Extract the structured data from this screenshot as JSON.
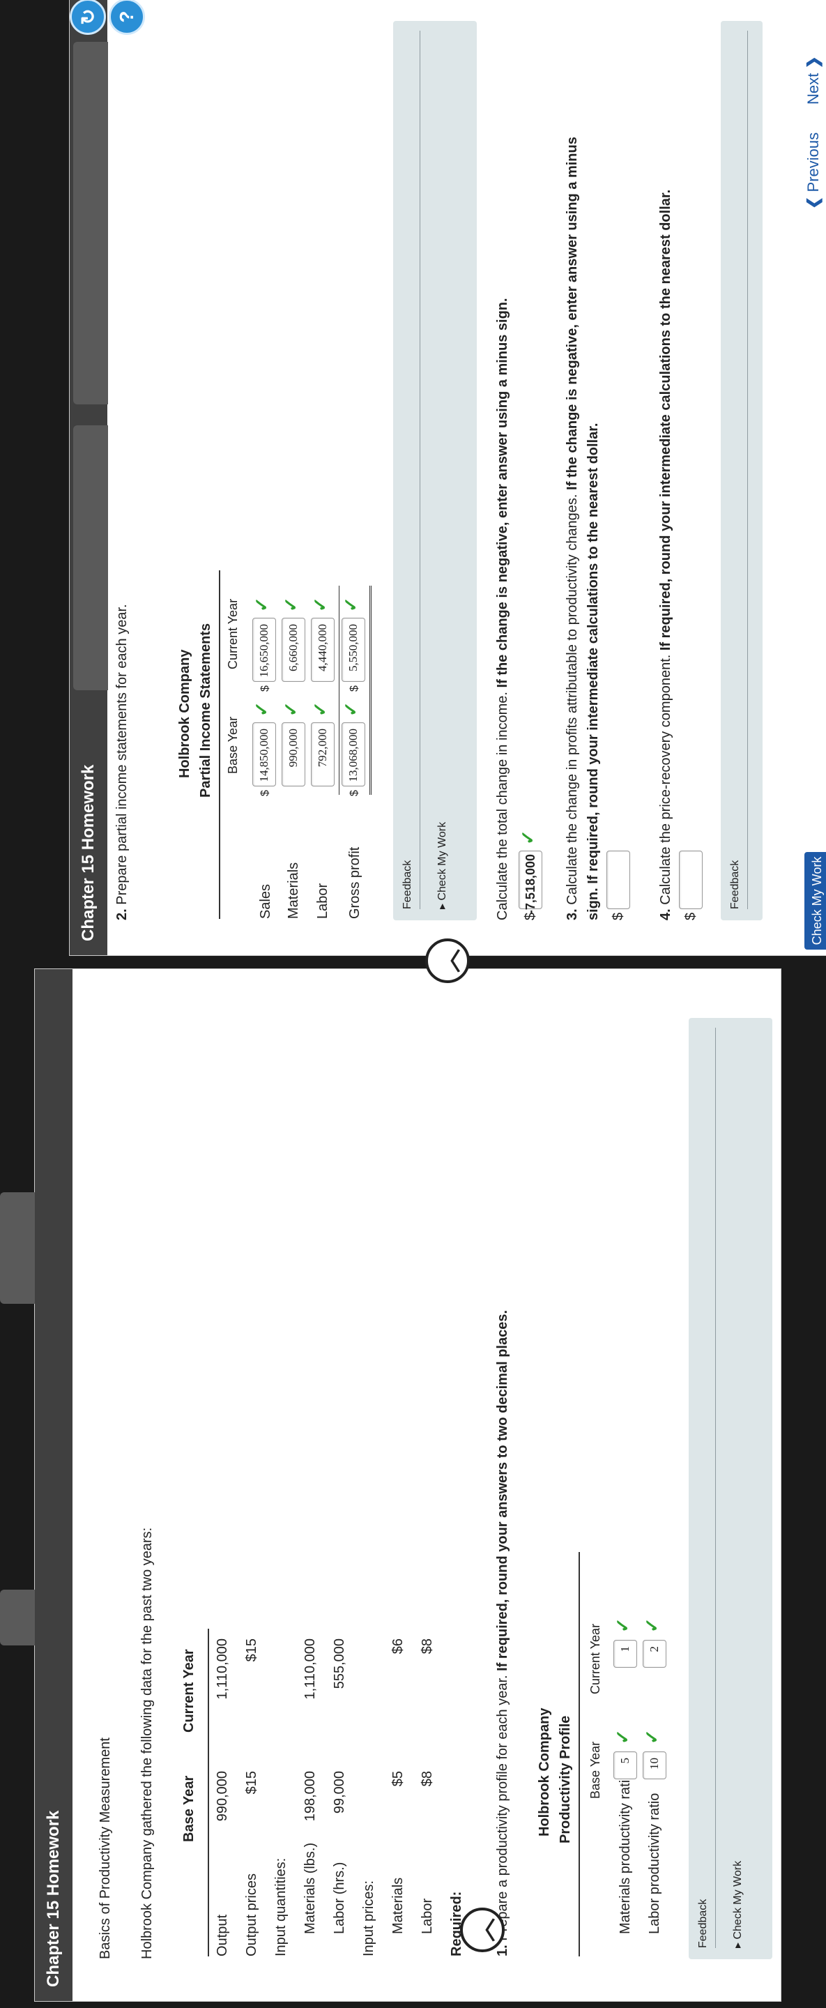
{
  "panel1": {
    "header": "Chapter 15 Homework",
    "title": "Basics of Productivity Measurement",
    "intro": "Holbrook Company gathered the following data for the past two years:",
    "table": {
      "col_base": "Base Year",
      "col_current": "Current Year",
      "rows": [
        {
          "label": "Output",
          "base": "990,000",
          "current": "1,110,000"
        },
        {
          "label": "Output prices",
          "base": "$15",
          "current": "$15"
        },
        {
          "label": "Input quantities:",
          "base": "",
          "current": ""
        },
        {
          "label": "Materials (lbs.)",
          "base": "198,000",
          "current": "1,110,000"
        },
        {
          "label": "Labor (hrs.)",
          "base": "99,000",
          "current": "555,000"
        },
        {
          "label": "Input prices:",
          "base": "",
          "current": ""
        },
        {
          "label": "Materials",
          "base": "$5",
          "current": "$6"
        },
        {
          "label": "Labor",
          "base": "$8",
          "current": "$8"
        }
      ]
    },
    "required_label": "Required:",
    "q1_prefix": "1.",
    "q1_text": "Prepare a productivity profile for each year.",
    "q1_bold": "If required, round your answers to two decimal places.",
    "profile": {
      "company": "Holbrook Company",
      "title": "Productivity Profile",
      "col_base": "Base Year",
      "col_current": "Current Year",
      "rows": [
        {
          "label": "Materials productivity ratio",
          "base": "5",
          "current": "1"
        },
        {
          "label": "Labor productivity ratio",
          "base": "10",
          "current": "2"
        }
      ]
    },
    "feedback_label": "Feedback",
    "check_my_work": "Check My Work"
  },
  "panel2": {
    "header": "Chapter 15 Homework",
    "q2_prefix": "2.",
    "q2_text": "Prepare partial income statements for each year.",
    "statement": {
      "company": "Holbrook Company",
      "title": "Partial Income Statements",
      "col_base": "Base Year",
      "col_current": "Current Year",
      "rows": [
        {
          "label": "Sales",
          "dollar": "$",
          "base": "14,850,000",
          "current": "16,650,000"
        },
        {
          "label": "Materials",
          "dollar": "",
          "base": "990,000",
          "current": "6,660,000"
        },
        {
          "label": "Labor",
          "dollar": "",
          "base": "792,000",
          "current": "4,440,000"
        },
        {
          "label": "Gross profit",
          "dollar": "$",
          "base": "13,068,000",
          "current": "5,550,000"
        }
      ]
    },
    "feedback_label": "Feedback",
    "check_my_work": "Check My Work",
    "total_change_text": "Calculate the total change in income.",
    "total_change_bold": "If the change is negative, enter answer using a minus sign.",
    "total_change_value": "-7,518,000",
    "q3_prefix": "3.",
    "q3_text": "Calculate the change in profits attributable to productivity changes.",
    "q3_bold_1": "If the change is negative, enter answer using a minus",
    "q3_bold_2": "sign. If required, round your intermediate calculations to the nearest dollar.",
    "q4_prefix": "4.",
    "q4_text": "Calculate the price-recovery component.",
    "q4_bold": "If required, round your intermediate calculations to the nearest dollar.",
    "feedback_label2": "Feedback",
    "check_my_work_button": "Check My Work",
    "previous": "Previous",
    "next": "Next",
    "dollar": "$"
  },
  "colors": {
    "header": "#404040",
    "check": "#2ea12e",
    "link": "#1e5aa8",
    "feedback_bg": "#dde6e8"
  }
}
